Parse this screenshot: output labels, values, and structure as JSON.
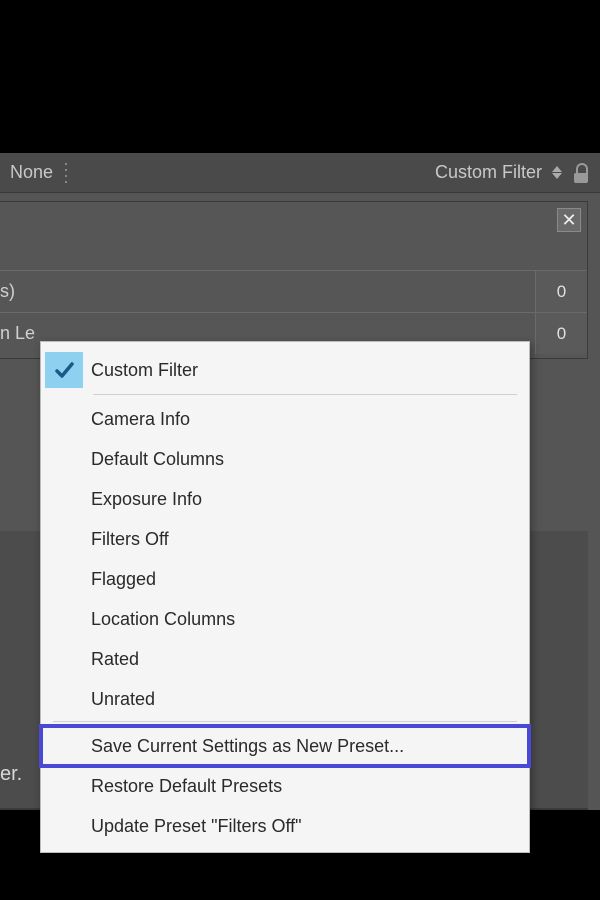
{
  "toolbar": {
    "left_label": "None",
    "filter_label": "Custom Filter"
  },
  "panel": {
    "row1_label_fragment": "s)",
    "row1_value": "0",
    "row2_label_fragment": "n Le",
    "row2_value": "0"
  },
  "bottom_panel": {
    "text_fragment": "er."
  },
  "menu": {
    "checked_label": "Custom Filter",
    "items_group1": [
      "Camera Info",
      "Default Columns",
      "Exposure Info",
      "Filters Off",
      "Flagged",
      "Location Columns",
      "Rated",
      "Unrated"
    ],
    "items_group2": [
      "Save Current Settings as New Preset...",
      "Restore Default Presets",
      "Update Preset \"Filters Off\""
    ],
    "highlighted_index": 0
  }
}
